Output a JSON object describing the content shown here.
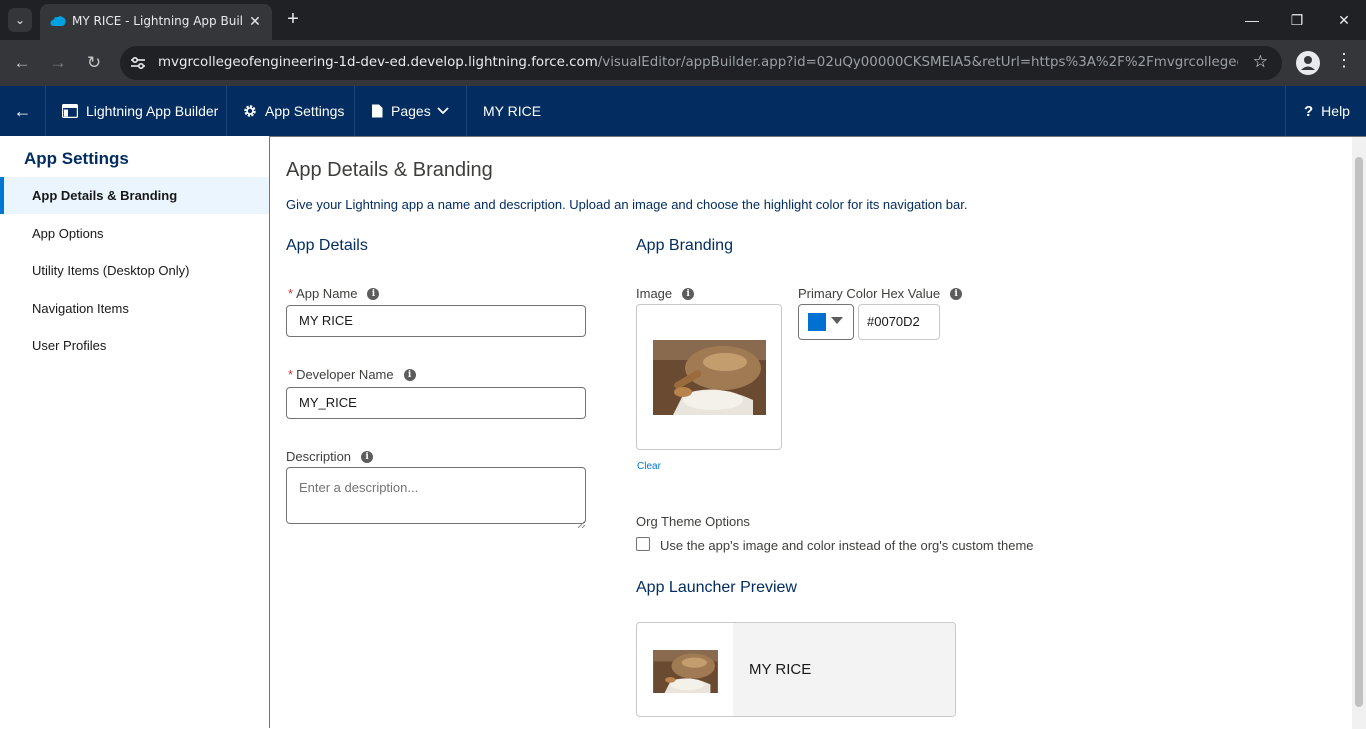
{
  "browser": {
    "tab_title": "MY RICE - Lightning App Builder",
    "url_host": "mvgrcollegeofengineering-1d-dev-ed.develop.lightning.force.com",
    "url_path": "/visualEditor/appBuilder.app?id=02uQy00000CKSMEIA5&retUrl=https%3A%2F%2Fmvgrcollegeofengineeri..."
  },
  "appbar": {
    "builder_label": "Lightning App Builder",
    "settings_label": "App Settings",
    "pages_label": "Pages",
    "app_name": "MY RICE",
    "help_label": "Help"
  },
  "leftnav": {
    "title": "App Settings",
    "items": [
      {
        "label": "App Details & Branding"
      },
      {
        "label": "App Options"
      },
      {
        "label": "Utility Items (Desktop Only)"
      },
      {
        "label": "Navigation Items"
      },
      {
        "label": "User Profiles"
      }
    ]
  },
  "main": {
    "title": "App Details & Branding",
    "description": "Give your Lightning app a name and description. Upload an image and choose the highlight color for its navigation bar.",
    "details_heading": "App Details",
    "app_name_label": "App Name",
    "app_name_value": "MY RICE",
    "dev_name_label": "Developer Name",
    "dev_name_value": "MY_RICE",
    "description_label": "Description",
    "description_placeholder": "Enter a description...",
    "branding_heading": "App Branding",
    "image_label": "Image",
    "clear_label": "Clear",
    "color_label": "Primary Color Hex Value",
    "color_value": "#0070D2",
    "org_theme_label": "Org Theme Options",
    "org_theme_checkbox": "Use the app's image and color instead of the org's custom theme",
    "launcher_heading": "App Launcher Preview",
    "launcher_app_name": "MY RICE"
  },
  "colors": {
    "header_bg": "#032d60",
    "accent": "#0176d3",
    "primary_swatch": "#0070D2"
  }
}
